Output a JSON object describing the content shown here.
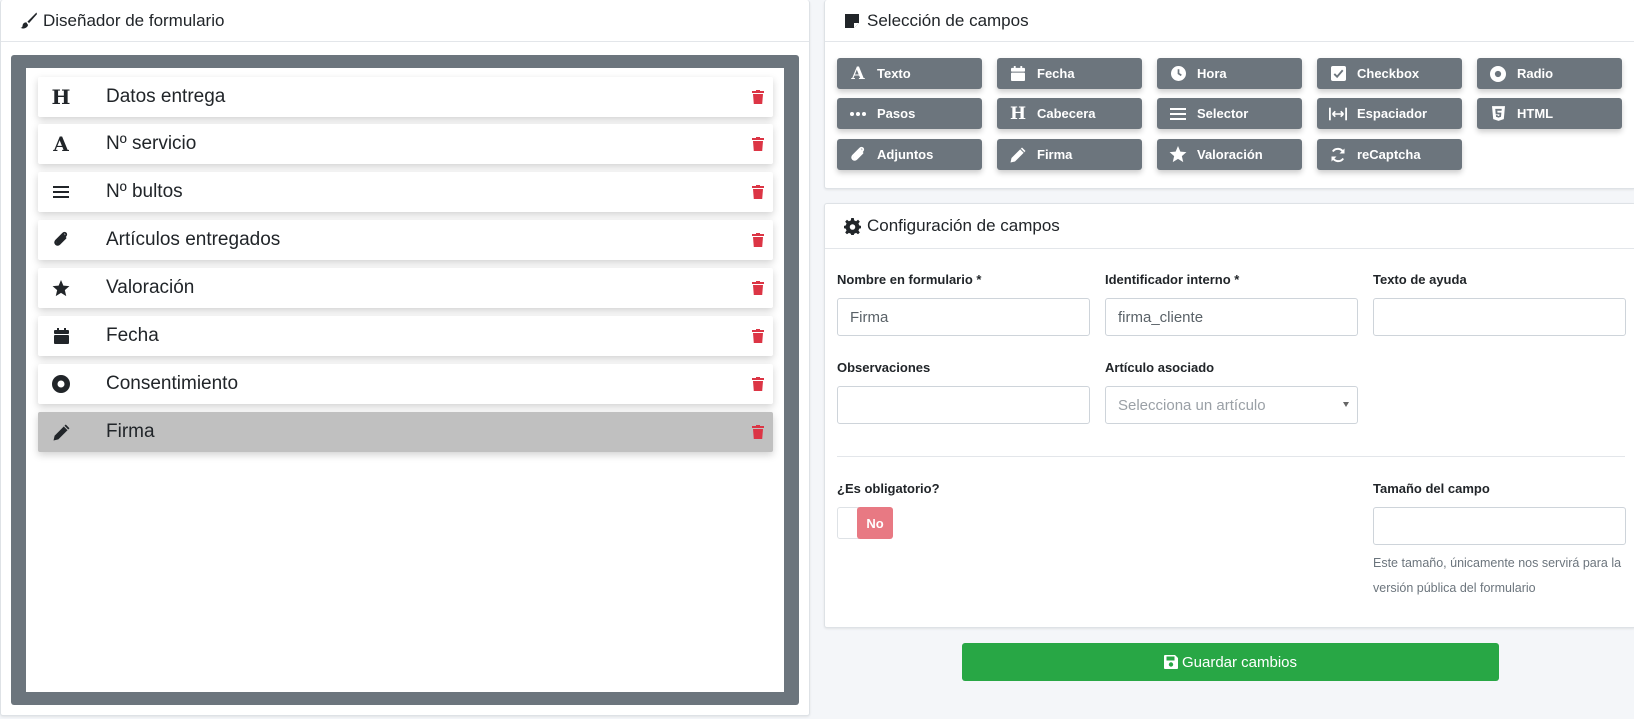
{
  "designer": {
    "title": "Diseñador de formulario",
    "items": [
      {
        "icon": "heading-icon",
        "glyph": "H",
        "label": "Datos entrega"
      },
      {
        "icon": "font-icon",
        "glyph": "A",
        "label": "Nº servicio"
      },
      {
        "icon": "bars-icon",
        "glyph": "≡",
        "label": "Nº bultos"
      },
      {
        "icon": "paperclip-icon",
        "glyph": "",
        "label": "Artículos entregados"
      },
      {
        "icon": "star-icon",
        "glyph": "★",
        "label": "Valoración"
      },
      {
        "icon": "calendar-icon",
        "glyph": "",
        "label": "Fecha"
      },
      {
        "icon": "dot-circle-icon",
        "glyph": "",
        "label": "Consentimiento"
      },
      {
        "icon": "pencil-icon",
        "glyph": "",
        "label": "Firma",
        "selected": true
      }
    ]
  },
  "selection": {
    "title": "Selección de campos",
    "buttons": [
      {
        "label": "Texto",
        "icon": "font-icon"
      },
      {
        "label": "Fecha",
        "icon": "calendar-icon"
      },
      {
        "label": "Hora",
        "icon": "clock-icon"
      },
      {
        "label": "Checkbox",
        "icon": "check-square-icon"
      },
      {
        "label": "Radio",
        "icon": "dot-circle-icon"
      },
      {
        "label": "Pasos",
        "icon": "ellipsis-icon"
      },
      {
        "label": "Cabecera",
        "icon": "heading-icon"
      },
      {
        "label": "Selector",
        "icon": "bars-icon"
      },
      {
        "label": "Espaciador",
        "icon": "arrows-h-icon"
      },
      {
        "label": "HTML",
        "icon": "html5-icon"
      },
      {
        "label": "Adjuntos",
        "icon": "paperclip-icon"
      },
      {
        "label": "Firma",
        "icon": "pencil-icon"
      },
      {
        "label": "Valoración",
        "icon": "star-icon"
      },
      {
        "label": "reCaptcha",
        "icon": "sync-icon"
      }
    ]
  },
  "config": {
    "title": "Configuración de campos",
    "nombre_label": "Nombre en formulario *",
    "nombre_value": "Firma",
    "identificador_label": "Identificador interno *",
    "identificador_value": "firma_cliente",
    "ayuda_label": "Texto de ayuda",
    "ayuda_value": "",
    "observaciones_label": "Observaciones",
    "observaciones_value": "",
    "articulo_label": "Artículo asociado",
    "articulo_placeholder": "Selecciona un artículo",
    "obligatorio_label": "¿Es obligatorio?",
    "obligatorio_value": "No",
    "tamano_label": "Tamaño del campo",
    "tamano_value": "",
    "tamano_help": "Este tamaño, únicamente nos servirá para la versión pública del formulario"
  },
  "save_label": "Guardar cambios",
  "colors": {
    "button_gray": "#6c757d",
    "danger": "#dc3545",
    "success": "#28a745",
    "toggle_no": "#e87983"
  }
}
